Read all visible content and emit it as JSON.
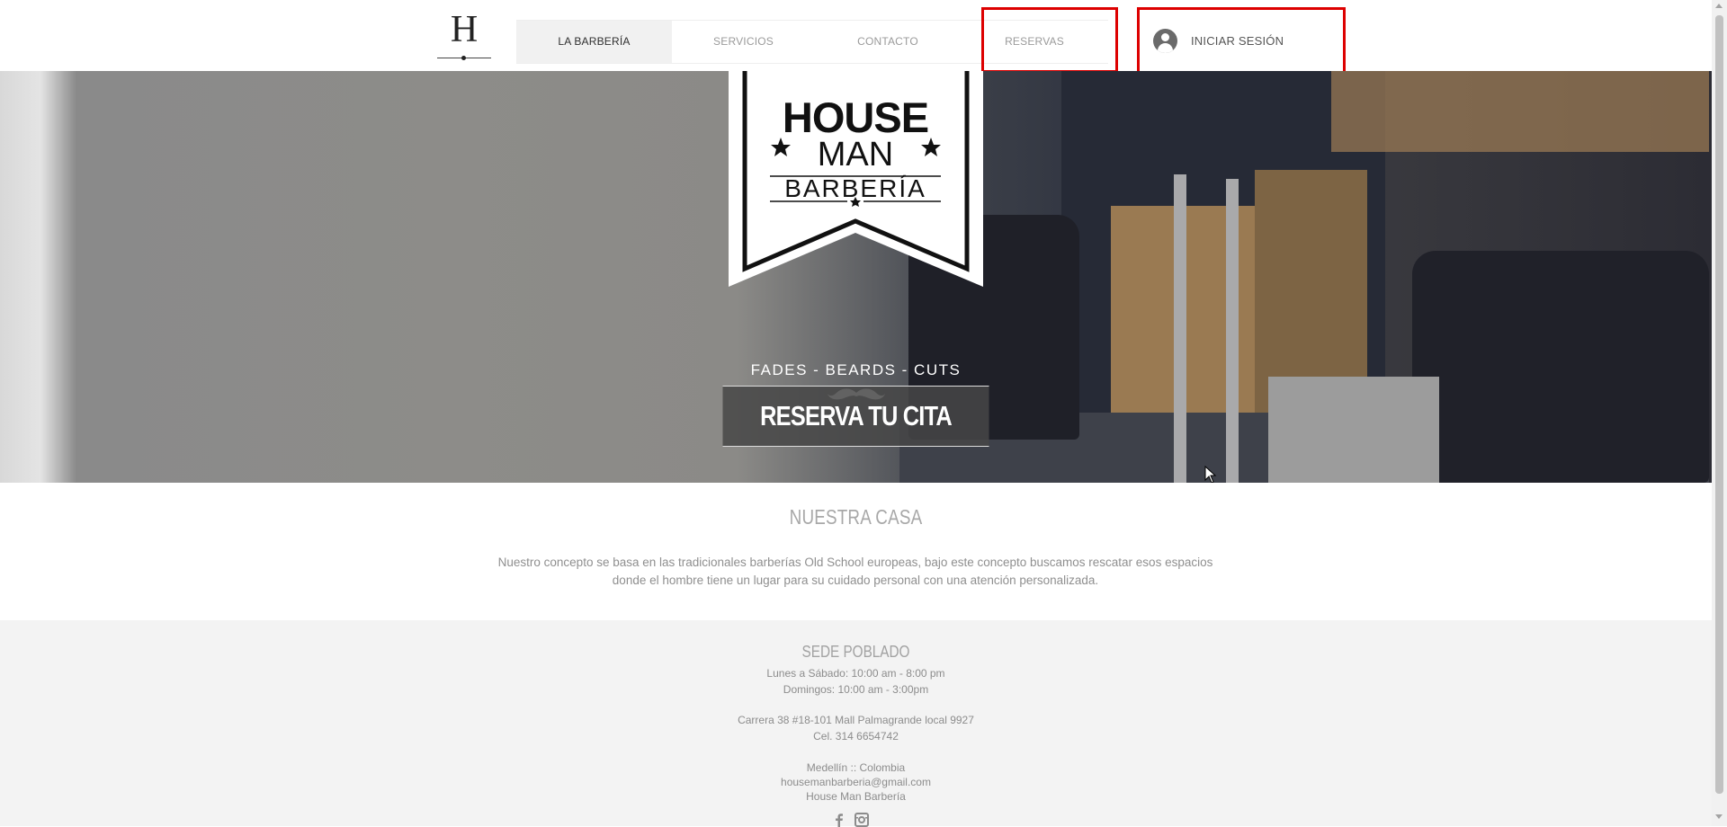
{
  "header": {
    "logo_letter": "H",
    "nav": [
      {
        "label": "LA BARBERÍA",
        "active": true
      },
      {
        "label": "SERVICIOS",
        "active": false
      },
      {
        "label": "CONTACTO",
        "active": false
      },
      {
        "label": "RESERVAS",
        "active": false
      }
    ],
    "login_label": "INICIAR SESIÓN",
    "login_icon": "user-avatar-icon"
  },
  "hero": {
    "logo_line1": "HOUSE",
    "logo_line2": "MAN",
    "logo_line3": "BARBERÍA",
    "tagline": "FADES - BEARDS - CUTS",
    "cta_label": "RESERVA TU CITA"
  },
  "about": {
    "title": "NUESTRA CASA",
    "text_line1": "Nuestro concepto se basa en las tradicionales barberías Old School europeas, bajo este concepto buscamos rescatar esos espacios",
    "text_line2": "donde el hombre tiene un lugar para su cuidado personal con una atención personalizada."
  },
  "footer": {
    "title": "SEDE POBLADO",
    "hours1": "Lunes a Sábado: 10:00 am - 8:00 pm",
    "hours2": "Domingos: 10:00 am - 3:00pm",
    "address": "Carrera 38 #18-101 Mall Palmagrande local 9927",
    "phone": "Cel. 314 6654742",
    "city": "Medellín :: Colombia",
    "email": "housemanbarberia@gmail.com",
    "name": "House Man Barbería",
    "social_icons": [
      "facebook-icon",
      "instagram-icon"
    ]
  },
  "colors": {
    "highlight": "#dd0000",
    "active_nav_bg": "#f1f1f1",
    "footer_bg": "#f3f3f3",
    "cta_bg": "#464646"
  }
}
